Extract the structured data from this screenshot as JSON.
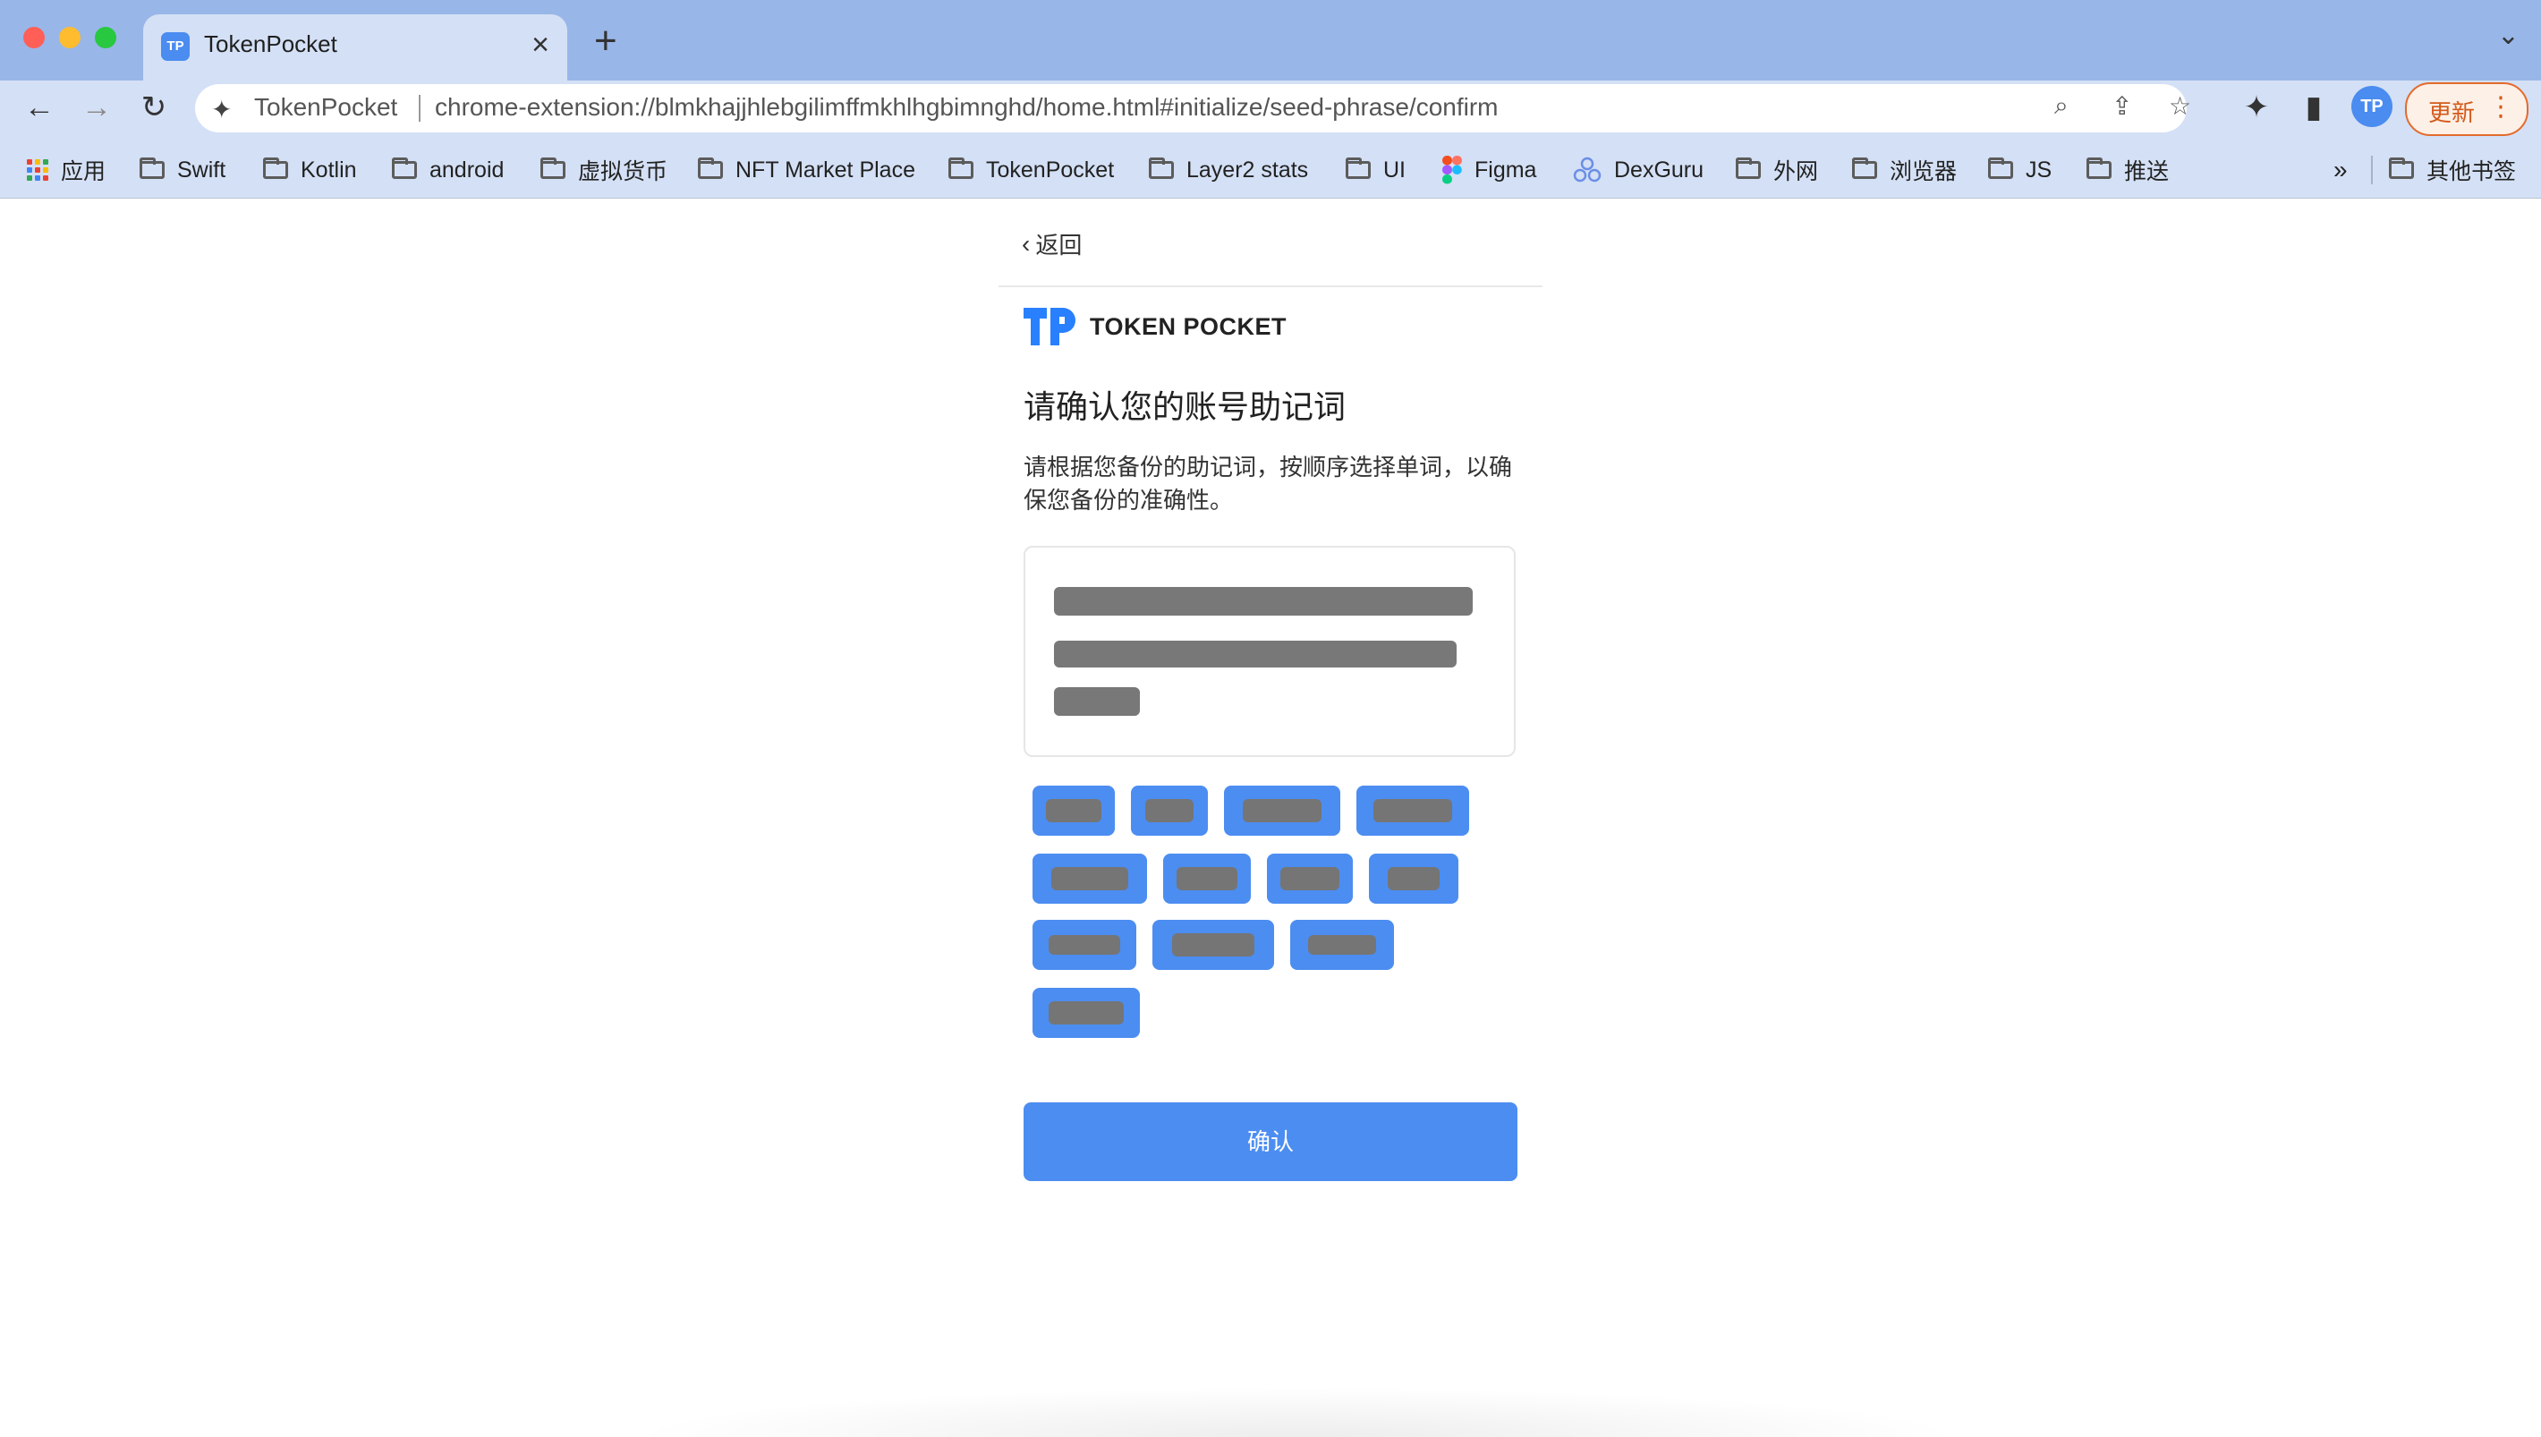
{
  "browser": {
    "tab_title": "TokenPocket",
    "tab_favicon": "TP",
    "address_title": "TokenPocket",
    "url": "chrome-extension://blmkhajjhlebgilimffmkhlhgbimnghd/home.html#initialize/seed-phrase/confirm",
    "profile_initials": "TP",
    "update_label": "更新"
  },
  "bookmarks": [
    {
      "label": "应用",
      "icon": "apps-grid-icon"
    },
    {
      "label": "Swift",
      "icon": "folder-icon"
    },
    {
      "label": "Kotlin",
      "icon": "folder-icon"
    },
    {
      "label": "android",
      "icon": "folder-icon"
    },
    {
      "label": "虚拟货币",
      "icon": "folder-icon"
    },
    {
      "label": "NFT Market Place",
      "icon": "folder-icon"
    },
    {
      "label": "TokenPocket",
      "icon": "folder-icon"
    },
    {
      "label": "Layer2 stats",
      "icon": "folder-icon"
    },
    {
      "label": "UI",
      "icon": "folder-icon"
    },
    {
      "label": "Figma",
      "icon": "figma-icon"
    },
    {
      "label": "DexGuru",
      "icon": "dexguru-icon"
    },
    {
      "label": "外网",
      "icon": "folder-icon"
    },
    {
      "label": "浏览器",
      "icon": "folder-icon"
    },
    {
      "label": "JS",
      "icon": "folder-icon"
    },
    {
      "label": "推送",
      "icon": "folder-icon"
    }
  ],
  "bookmarks_overflow": "»",
  "other_bookmarks": "其他书签",
  "page": {
    "back_label": "返回",
    "logo_text": "TOKEN POCKET",
    "heading": "请确认您的账号助记词",
    "description": "请根据您备份的助记词，按顺序选择单词，以确保您备份的准确性。",
    "confirm_label": "确认",
    "seed_words_count": 12
  },
  "colors": {
    "accent": "#4c8df1",
    "redacted": "#777777",
    "tabstrip": "#98b6e8",
    "toolbar": "#d4e0f5",
    "update": "#e36b2c"
  }
}
